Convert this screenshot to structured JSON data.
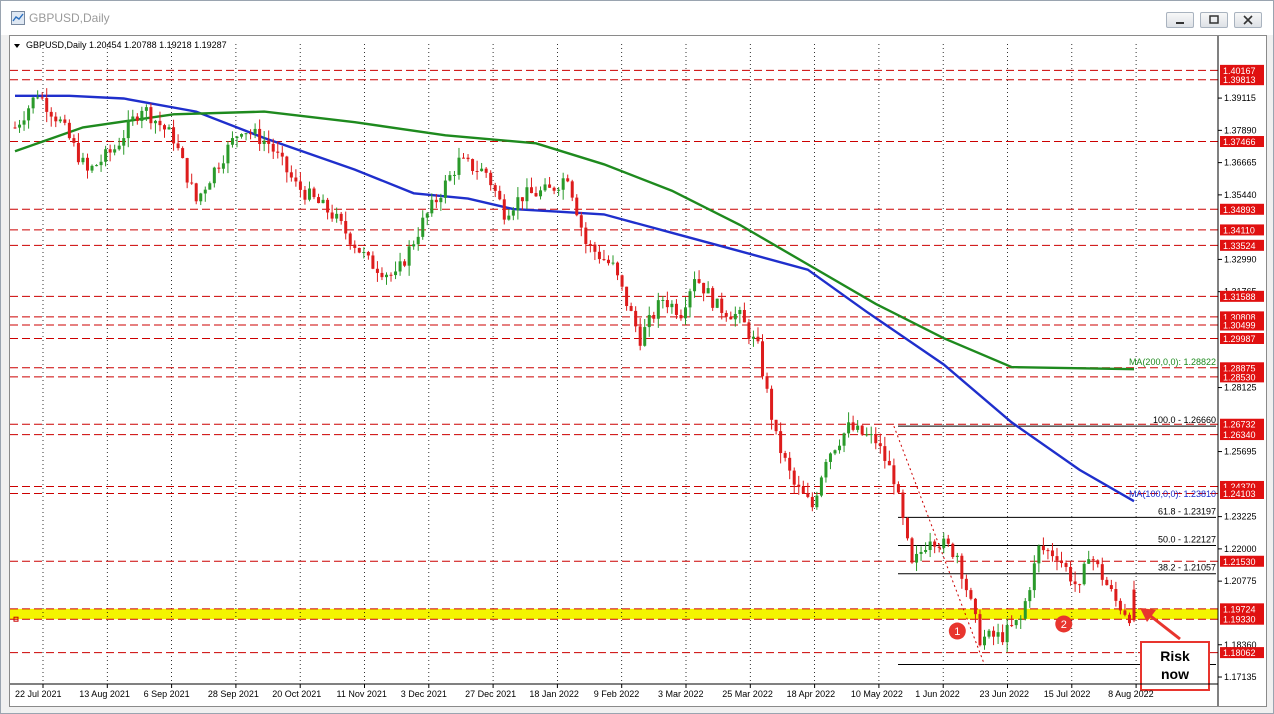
{
  "window": {
    "title": "GBPUSD,Daily"
  },
  "chart_header": {
    "text": "GBPUSD,Daily  1.20454 1.20788 1.19218 1.19287"
  },
  "colors": {
    "bull": "#2a9a2a",
    "bear": "#dd1c1c",
    "ma100": "#1f2fcc",
    "ma200": "#1e8a1e",
    "level_line": "#cc0000",
    "price_tag": "#e01010",
    "support_zone": "#f4f400",
    "annotation": "#e8352e"
  },
  "chart_data": {
    "type": "candlestick",
    "symbol": "GBPUSD",
    "timeframe": "Daily",
    "ohlc_last": {
      "open": 1.20454,
      "high": 1.20788,
      "low": 1.19218,
      "close": 1.19287
    },
    "ylim": [
      1.1687,
      1.4132
    ],
    "y_ticks": [
      "1.39115",
      "1.37890",
      "1.36665",
      "1.35440",
      "1.32990",
      "1.31765",
      "1.28125",
      "1.25695",
      "1.23225",
      "1.22000",
      "1.20775",
      "1.18360",
      "1.17135"
    ],
    "x_ticks": [
      "22 Jul 2021",
      "13 Aug 2021",
      "6 Sep 2021",
      "28 Sep 2021",
      "20 Oct 2021",
      "11 Nov 2021",
      "3 Dec 2021",
      "27 Dec 2021",
      "18 Jan 2022",
      "9 Feb 2022",
      "3 Mar 2022",
      "25 Mar 2022",
      "18 Apr 2022",
      "10 May 2022",
      "1 Jun 2022",
      "23 Jun 2022",
      "15 Jul 2022",
      "8 Aug 2022"
    ],
    "price_levels": [
      "1.40167",
      "1.39813",
      "1.37466",
      "1.34893",
      "1.34110",
      "1.33524",
      "1.31588",
      "1.30808",
      "1.30499",
      "1.29987",
      "1.28875",
      "1.28530",
      "1.26732",
      "1.26340",
      "1.24370",
      "1.24103",
      "1.21530",
      "1.19724",
      "1.19330",
      "1.18062"
    ],
    "support_zone": [
      1.1933,
      1.19724
    ],
    "fibonacci": {
      "labels": [
        "100.0 - 1.26660",
        "61.8 - 1.23197",
        "50.0 - 1.22127",
        "38.2 - 1.21057"
      ],
      "values": [
        1.2666,
        1.23197,
        1.22127,
        1.21057,
        1.1761
      ]
    },
    "moving_averages": [
      {
        "label": "MA(100,0,0): 1.23810",
        "value": 1.2381,
        "path": [
          [
            0,
            1.392
          ],
          [
            12,
            1.392
          ],
          [
            24,
            1.391
          ],
          [
            40,
            1.386
          ],
          [
            55,
            1.376
          ],
          [
            75,
            1.364
          ],
          [
            88,
            1.355
          ],
          [
            100,
            1.353
          ],
          [
            110,
            1.349
          ],
          [
            120,
            1.348
          ],
          [
            130,
            1.347
          ],
          [
            145,
            1.34
          ],
          [
            160,
            1.333
          ],
          [
            175,
            1.326
          ],
          [
            188,
            1.31
          ],
          [
            205,
            1.29
          ],
          [
            220,
            1.268
          ],
          [
            235,
            1.25
          ],
          [
            247,
            1.2381
          ]
        ]
      },
      {
        "label": "MA(200,0,0): 1.28822",
        "value": 1.28822,
        "path": [
          [
            0,
            1.371
          ],
          [
            15,
            1.38
          ],
          [
            35,
            1.385
          ],
          [
            55,
            1.386
          ],
          [
            75,
            1.382
          ],
          [
            95,
            1.377
          ],
          [
            115,
            1.374
          ],
          [
            130,
            1.366
          ],
          [
            145,
            1.356
          ],
          [
            160,
            1.343
          ],
          [
            175,
            1.328
          ],
          [
            190,
            1.313
          ],
          [
            205,
            1.3
          ],
          [
            220,
            1.289
          ],
          [
            247,
            1.28822
          ]
        ]
      }
    ],
    "anchors": [
      [
        0,
        1.38
      ],
      [
        5,
        1.393
      ],
      [
        10,
        1.382
      ],
      [
        16,
        1.363
      ],
      [
        22,
        1.372
      ],
      [
        28,
        1.388
      ],
      [
        35,
        1.376
      ],
      [
        40,
        1.352
      ],
      [
        44,
        1.364
      ],
      [
        50,
        1.38
      ],
      [
        56,
        1.374
      ],
      [
        62,
        1.358
      ],
      [
        70,
        1.347
      ],
      [
        78,
        1.329
      ],
      [
        84,
        1.323
      ],
      [
        90,
        1.344
      ],
      [
        98,
        1.367
      ],
      [
        104,
        1.363
      ],
      [
        108,
        1.348
      ],
      [
        112,
        1.354
      ],
      [
        118,
        1.356
      ],
      [
        122,
        1.362
      ],
      [
        126,
        1.336
      ],
      [
        132,
        1.327
      ],
      [
        138,
        1.3
      ],
      [
        143,
        1.315
      ],
      [
        147,
        1.31
      ],
      [
        150,
        1.324
      ],
      [
        155,
        1.312
      ],
      [
        160,
        1.308
      ],
      [
        164,
        1.296
      ],
      [
        168,
        1.262
      ],
      [
        172,
        1.244
      ],
      [
        176,
        1.236
      ],
      [
        179,
        1.255
      ],
      [
        184,
        1.266
      ],
      [
        190,
        1.261
      ],
      [
        194,
        1.247
      ],
      [
        198,
        1.213
      ],
      [
        202,
        1.225
      ],
      [
        208,
        1.218
      ],
      [
        213,
        1.186
      ],
      [
        218,
        1.187
      ],
      [
        222,
        1.193
      ],
      [
        226,
        1.22
      ],
      [
        230,
        1.218
      ],
      [
        235,
        1.204
      ],
      [
        237,
        1.219
      ],
      [
        243,
        1.2
      ],
      [
        247,
        1.19287
      ]
    ],
    "annotations": {
      "marker_1": "1",
      "marker_2": "2",
      "risk_box": [
        "Risk",
        "now"
      ]
    },
    "grid": false
  }
}
